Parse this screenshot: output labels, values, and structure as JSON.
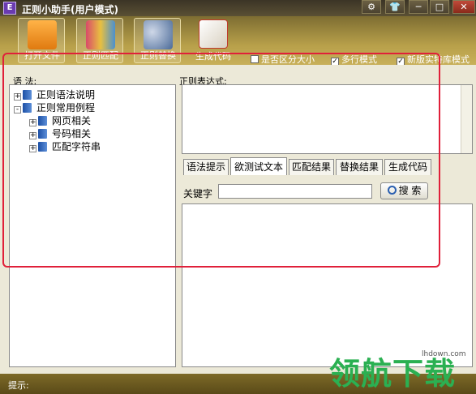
{
  "window": {
    "title": "正则小助手(用户模式)",
    "app_icon_text": "E"
  },
  "title_buttons": [
    {
      "icon": "gear-icon",
      "glyph": "⚙"
    },
    {
      "icon": "shirt-icon",
      "glyph": "👕"
    },
    {
      "icon": "minimize-icon",
      "glyph": "─"
    },
    {
      "icon": "maximize-icon",
      "glyph": "□"
    },
    {
      "icon": "close-icon",
      "glyph": "✕"
    }
  ],
  "toolbar": {
    "tools": [
      {
        "label": "打开文件",
        "icon": "folder-icon",
        "color": "#f08a1a"
      },
      {
        "label": "正则匹配",
        "icon": "books-icon",
        "color": "#d94a6a"
      },
      {
        "label": "正则替换",
        "icon": "binoculars-icon",
        "color": "#5a7fb8"
      },
      {
        "label": "生成代码",
        "icon": "notepad-icon",
        "color": "#e8e2d2"
      }
    ],
    "options": [
      {
        "label": "是否区分大小",
        "checked": false
      },
      {
        "label": "多行模式",
        "checked": true
      },
      {
        "label": "新版实",
        "checked": true
      }
    ],
    "extra_label": "特库模式"
  },
  "labels": {
    "grammar": "语  法:",
    "regex": "正则表达式:",
    "keyword": "关键字",
    "search": "搜 索",
    "status": "提示:"
  },
  "tree": [
    {
      "label": "正则语法说明",
      "expander": "+",
      "level": 0
    },
    {
      "label": "正则常用例程",
      "expander": "-",
      "level": 0
    },
    {
      "label": "网页相关",
      "expander": "+",
      "level": 1
    },
    {
      "label": "号码相关",
      "expander": "+",
      "level": 1
    },
    {
      "label": "匹配字符串",
      "expander": "+",
      "level": 1
    }
  ],
  "tabs": [
    {
      "label": "语法提示",
      "active": false
    },
    {
      "label": "欲测试文本",
      "active": true
    },
    {
      "label": "匹配结果",
      "active": false
    },
    {
      "label": "替换结果",
      "active": false
    },
    {
      "label": "生成代码",
      "active": false
    }
  ],
  "watermark": {
    "text": "领航下载",
    "url": "lhdown.com"
  }
}
